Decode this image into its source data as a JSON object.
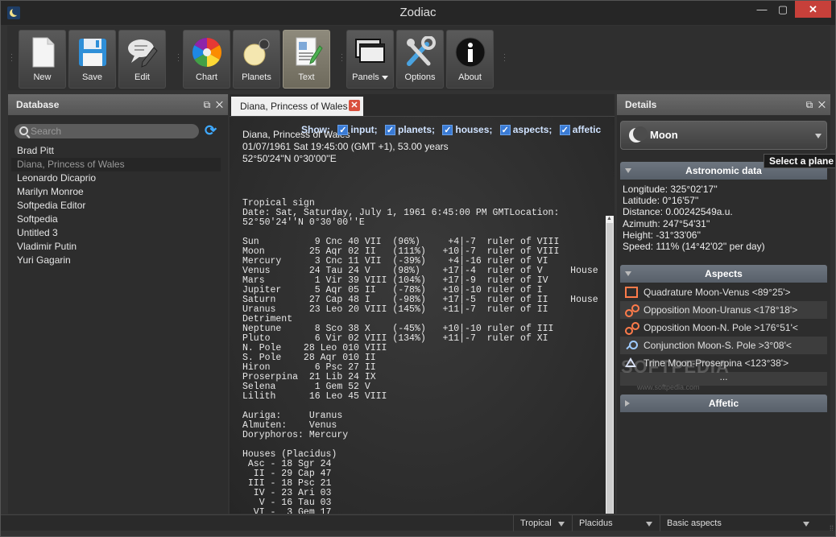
{
  "window": {
    "title": "Zodiac",
    "minimize": "—",
    "maximize": "▢",
    "close": "✕"
  },
  "toolbar": {
    "buttons": [
      {
        "id": "new",
        "label": "New",
        "icon": "new-document-icon"
      },
      {
        "id": "save",
        "label": "Save",
        "icon": "floppy-disk-icon"
      },
      {
        "id": "edit",
        "label": "Edit",
        "icon": "edit-speech-pencil-icon"
      },
      {
        "id": "chart",
        "label": "Chart",
        "icon": "color-wheel-icon"
      },
      {
        "id": "planets",
        "label": "Planets",
        "icon": "planets-icon"
      },
      {
        "id": "text",
        "label": "Text",
        "icon": "text-document-icon"
      },
      {
        "id": "panels",
        "label": "Panels",
        "icon": "panels-icon"
      },
      {
        "id": "options",
        "label": "Options",
        "icon": "tools-icon"
      },
      {
        "id": "about",
        "label": "About",
        "icon": "info-icon"
      }
    ]
  },
  "database": {
    "title": "Database",
    "search_placeholder": "Search",
    "items": [
      "Brad Pitt",
      "Diana, Princess of Wales",
      "Leonardo Dicaprio",
      "Marilyn Monroe",
      "Softpedia Editor",
      "Softpedia",
      "Untitled 3",
      "Vladimir Putin",
      "Yuri Gagarin"
    ],
    "selected_index": 1
  },
  "document": {
    "tab_label": "Diana, Princess of Wales",
    "tab_close": "✕",
    "header_lines": [
      "Diana, Princess of Wales",
      "01/07/1961 Sat 19:45:00 (GMT +1), 53.00 years",
      "52°50'24''N  0°30'00''E"
    ],
    "show_label": "Show:",
    "show_options": [
      "input;",
      "planets;",
      "houses;",
      "aspects;",
      "affetic"
    ],
    "report": "Tropical sign\nDate: Sat, Saturday, July 1, 1961 6:45:00 PM GMTLocation:\n52°50'24''N 0°30'00''E\n\nSun          9 Cnc 40 VII  (96%)     +4|-7  ruler of VIII\nMoon        25 Aqr 02 II   (111%)   +10|-7  ruler of VIII\nMercury      3 Cnc 11 VII  (-39%)    +4|-16 ruler of VI\nVenus       24 Tau 24 V    (98%)    +17|-4  ruler of V     House\nMars         1 Vir 39 VIII (104%)   +17|-9  ruler of IV\nJupiter      5 Aqr 05 II   (-78%)   +10|-10 ruler of I\nSaturn      27 Cap 48 I    (-98%)   +17|-5  ruler of II    House\nUranus      23 Leo 20 VIII (145%)   +11|-7  ruler of II\nDetriment\nNeptune      8 Sco 38 X    (-45%)   +10|-10 ruler of III\nPluto        6 Vir 02 VIII (134%)   +11|-7  ruler of XI\nN. Pole    28 Leo 010 VIII\nS. Pole    28 Aqr 010 II\nHiron        6 Psc 27 II\nProserpina  21 Lib 24 IX\nSelena       1 Gem 52 V\nLilith      16 Leo 45 VIII\n\nAuriga:     Uranus\nAlmuten:    Venus\nDoryphoros: Mercury\n\nHouses (Placidus)\n Asc - 18 Sgr 24\n  II - 29 Cap 47\n III - 18 Psc 21\n  IV - 23 Ari 03\n   V - 16 Tau 03\n  VI -  3 Gem 17"
  },
  "details": {
    "title": "Details",
    "planet": "Moon",
    "tooltip": "Select a plane",
    "astronomic_title": "Astronomic data",
    "astronomic": [
      "Longitude: 325°02'17''",
      "Latitude: 0°16'57''",
      "Distance: 0.00242549a.u.",
      "Azimuth: 247°54'31''",
      "Height: -31°33'06''",
      "Speed: 111% (14°42'02'' per day)"
    ],
    "aspects_title": "Aspects",
    "aspects": [
      {
        "text": "Quadrature Moon-Venus <89°25'>",
        "icon": "quadrature-icon"
      },
      {
        "text": "Opposition Moon-Uranus <178°18'>",
        "icon": "opposition-icon"
      },
      {
        "text": "Opposition Moon-N. Pole >176°51'<",
        "icon": "opposition-icon"
      },
      {
        "text": "Conjunction Moon-S. Pole >3°08'<",
        "icon": "conjunction-icon"
      },
      {
        "text": "Trine Moon-Proserpina <123°38'>",
        "icon": "trine-icon"
      }
    ],
    "aspects_more": "...",
    "affetic_title": "Affetic"
  },
  "watermark": {
    "text": "SOFTPEDIA",
    "url": "www.softpedia.com"
  },
  "statusbar": {
    "zodiac": "Tropical",
    "houses": "Placidus",
    "aspects": "Basic aspects"
  }
}
